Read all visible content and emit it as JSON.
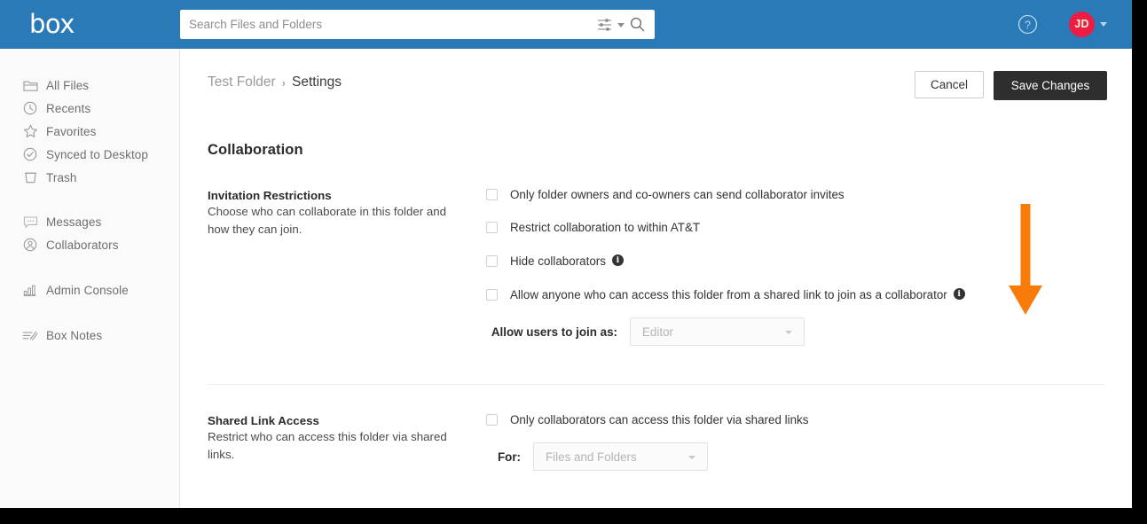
{
  "brand": {
    "logo_text": "box",
    "header_color": "#2a7ab8",
    "accent_color": "#ed1c42",
    "annotation_color": "#f97c0b"
  },
  "topbar": {
    "search": {
      "placeholder": "Search Files and Folders",
      "value": "",
      "filter_icon": "sliders-icon",
      "caret_icon": "chevron-down-icon",
      "search_icon": "search-icon"
    },
    "help_icon": "help-circle-icon",
    "avatar_initials": "JD",
    "avatar_caret_icon": "chevron-down-icon"
  },
  "sidebar": {
    "items": [
      {
        "label": "All Files",
        "icon": "folder-icon"
      },
      {
        "label": "Recents",
        "icon": "clock-icon"
      },
      {
        "label": "Favorites",
        "icon": "star-icon"
      },
      {
        "label": "Synced to Desktop",
        "icon": "check-circle-icon"
      },
      {
        "label": "Trash",
        "icon": "trash-icon"
      },
      {
        "label": "Messages",
        "icon": "message-bubble-icon"
      },
      {
        "label": "Collaborators",
        "icon": "user-circle-icon"
      },
      {
        "label": "Admin Console",
        "icon": "bar-chart-icon"
      },
      {
        "label": "Box Notes",
        "icon": "notes-pencil-icon"
      }
    ]
  },
  "main": {
    "breadcrumb": {
      "parent": "Test Folder",
      "separator": "›",
      "current": "Settings"
    },
    "actions": {
      "cancel_label": "Cancel",
      "save_label": "Save Changes"
    },
    "section_title": "Collaboration",
    "invitation": {
      "heading": "Invitation Restrictions",
      "description": "Choose who can collaborate in this folder and how they can join.",
      "options": [
        {
          "label": "Only folder owners and co-owners can send collaborator invites",
          "checked": false,
          "info": false
        },
        {
          "label": "Restrict collaboration to within AT&T",
          "checked": false,
          "info": false
        },
        {
          "label": "Hide collaborators",
          "checked": false,
          "info": true
        },
        {
          "label": "Allow anyone who can access this folder from a shared link to join as a collaborator",
          "checked": false,
          "info": true
        }
      ],
      "join_as": {
        "label": "Allow users to join as:",
        "value": "Editor",
        "disabled": true
      }
    },
    "shared_link": {
      "heading": "Shared Link Access",
      "description": "Restrict who can access this folder via shared links.",
      "options": [
        {
          "label": "Only collaborators can access this folder via shared links",
          "checked": false,
          "info": false
        }
      ],
      "for": {
        "label": "For:",
        "value": "Files and Folders",
        "disabled": true
      }
    }
  },
  "annotation": {
    "arrow_icon": "down-arrow-annotation"
  }
}
